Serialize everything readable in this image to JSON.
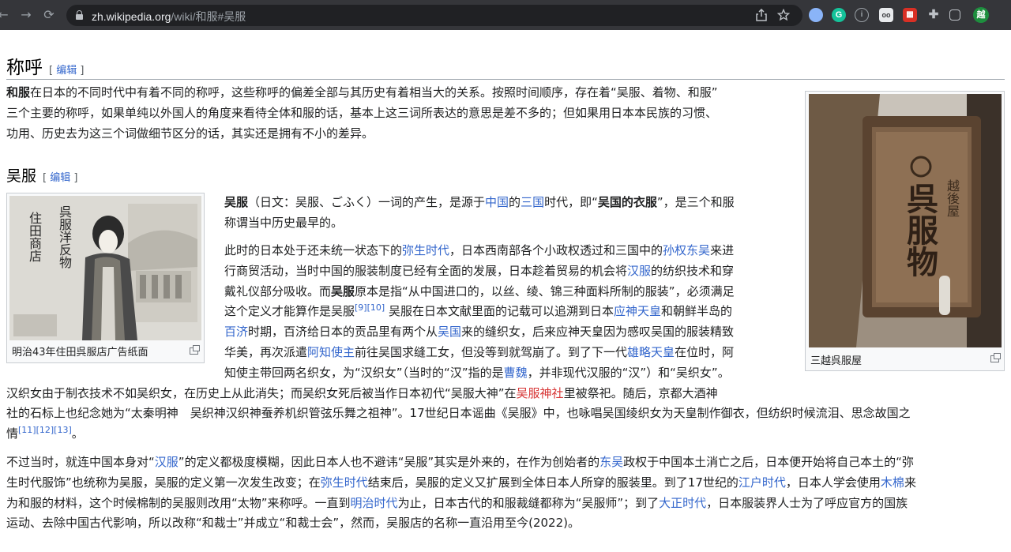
{
  "browser": {
    "url_host": "zh.wikipedia.org",
    "url_path": "/wiki/和服#吴服",
    "nav": {
      "back": "←",
      "forward": "→",
      "reload": "⟳"
    },
    "profile_initial": "越"
  },
  "sections": {
    "chenghu": {
      "heading": "称呼",
      "edit_label": "编辑",
      "paragraph": [
        {
          "b": "和服"
        },
        {
          "t": "在日本的不同时代中有着不同的称呼，这些称呼的偏差全部与其历史有着相当大的关系。按照时间顺序，存在着“吴服、着物、和服”"
        },
        {
          "br": 1
        },
        {
          "t": "三个主要的称呼，如果单纯以外国人的角度来看待全体和服的话，基本上这三词所表达的意思是差不多的；但如果用日本本民族的习惯、"
        },
        {
          "br": 1
        },
        {
          "t": "功用、历史去为这三个词做细节区分的话，其实还是拥有不小的差异。"
        }
      ]
    },
    "wufu": {
      "heading": "吴服",
      "edit_label": "编辑",
      "para1": [
        {
          "b": "吴服"
        },
        {
          "t": "（日文：吴服、ごふく）一词的产生，是源于"
        },
        {
          "a": "中国"
        },
        {
          "t": "的"
        },
        {
          "a": "三国"
        },
        {
          "t": "时代，即“"
        },
        {
          "b": "吴国的衣服"
        },
        {
          "t": "”，是三个和服"
        },
        {
          "br": 1
        },
        {
          "t": "称谓当中历史最早的。"
        }
      ],
      "para2": [
        {
          "t": "此时的日本处于还未统一状态下的"
        },
        {
          "a": "弥生时代"
        },
        {
          "t": "，日本西南部各个小政权透过和三国中的"
        },
        {
          "a": "孙权东吴"
        },
        {
          "t": "来进"
        },
        {
          "br": 1
        },
        {
          "t": "行商贸活动，当时中国的服装制度已经有全面的发展，日本趁着贸易的机会将"
        },
        {
          "a": "汉服"
        },
        {
          "t": "的纺织技术和穿"
        },
        {
          "br": 1
        },
        {
          "t": "戴礼仪部分吸收。而"
        },
        {
          "b": "吴服"
        },
        {
          "t": "原本是指“从中国进口的，以丝、绫、锦三种面料所制的服装”，必须满足"
        },
        {
          "br": 1
        },
        {
          "t": "这个定义才能算作是吴服"
        },
        {
          "sup": "[9][10]"
        },
        {
          "t": " 吴服在日本文献里面的记载可以追溯到日本"
        },
        {
          "a": "应神天皇"
        },
        {
          "t": "和朝鲜半岛的"
        },
        {
          "br": 1
        },
        {
          "a": "百济"
        },
        {
          "t": "时期，百济给日本的贡品里有两个从"
        },
        {
          "a": "吴国"
        },
        {
          "t": "来的缝织女，后来应神天皇因为感叹吴国的服装精致"
        },
        {
          "br": 1
        },
        {
          "t": "华美，再次派遣"
        },
        {
          "a": "阿知使主"
        },
        {
          "t": "前往吴国求缝工女，但没等到就驾崩了。到了下一代"
        },
        {
          "a": "雄略天皇"
        },
        {
          "t": "在位时，阿"
        },
        {
          "br": 1
        },
        {
          "t": "知使主带回两名织女，为“汉织女”（当时的“汉”指的是"
        },
        {
          "a": "曹魏"
        },
        {
          "t": "，并非现代汉服的“汉”）和“吴织女”。"
        },
        {
          "br": 1
        },
        {
          "t": "汉织女由于制衣技术不如吴织女，在历史上从此消失；而吴织女死后被当作日本初代“吴服大神”在"
        },
        {
          "n": "吴服神社"
        },
        {
          "t": "里被祭祀。随后，京都大酒神"
        },
        {
          "br": 1
        },
        {
          "t": "社的石标上也纪念她为“太秦明神　吴织神汉织神蚕养机织管弦乐舞之祖神”。17世纪日本谣曲《吴服》中，也咏唱吴国绫织女为天皇制作御衣，但纺织时候流泪、思念故国之"
        },
        {
          "br": 1
        },
        {
          "t": "情"
        },
        {
          "sup": "[11][12][13]"
        },
        {
          "t": "。"
        }
      ],
      "para3": [
        {
          "t": "不过当时，就连中国本身对“"
        },
        {
          "a": "汉服"
        },
        {
          "t": "”的定义都极度模糊，因此日本人也不避讳“吴服”其实是外来的，在作为创始者的"
        },
        {
          "a": "东吴"
        },
        {
          "t": "政权于中国本土消亡之后，日本便开始将自己本土的“弥"
        },
        {
          "br": 1
        },
        {
          "t": "生时代服饰”也统称为吴服，吴服的定义第一次发生改变；在"
        },
        {
          "a": "弥生时代"
        },
        {
          "t": "结束后，吴服的定义又扩展到全体日本人所穿的服装里。到了17世纪的"
        },
        {
          "a": "江户时代"
        },
        {
          "t": "，日本人学会使用"
        },
        {
          "a": "木棉"
        },
        {
          "t": "来"
        },
        {
          "br": 1
        },
        {
          "t": "为和服的材料，这个时候棉制的吴服则改用“太物”来称呼。一直到"
        },
        {
          "a": "明治时代"
        },
        {
          "t": "为止，日本古代的和服裁缝都称为“吴服师”；到了"
        },
        {
          "a": "大正时代"
        },
        {
          "t": "，日本服装界人士为了呼应官方的国族"
        },
        {
          "br": 1
        },
        {
          "t": "运动、去除中国古代影响，所以改称“和裁士”并成立“和裁士会”，然而，吴服店的名称一直沿用至今(2022)。"
        }
      ]
    }
  },
  "figures": {
    "left": {
      "caption": "明治43年住田呉服店广告纸面",
      "image_text": [
        "住田商店",
        "呉服洋反物"
      ]
    },
    "right": {
      "caption": "三越呉服屋",
      "image_text": [
        "呉服物",
        "越後屋"
      ]
    }
  }
}
